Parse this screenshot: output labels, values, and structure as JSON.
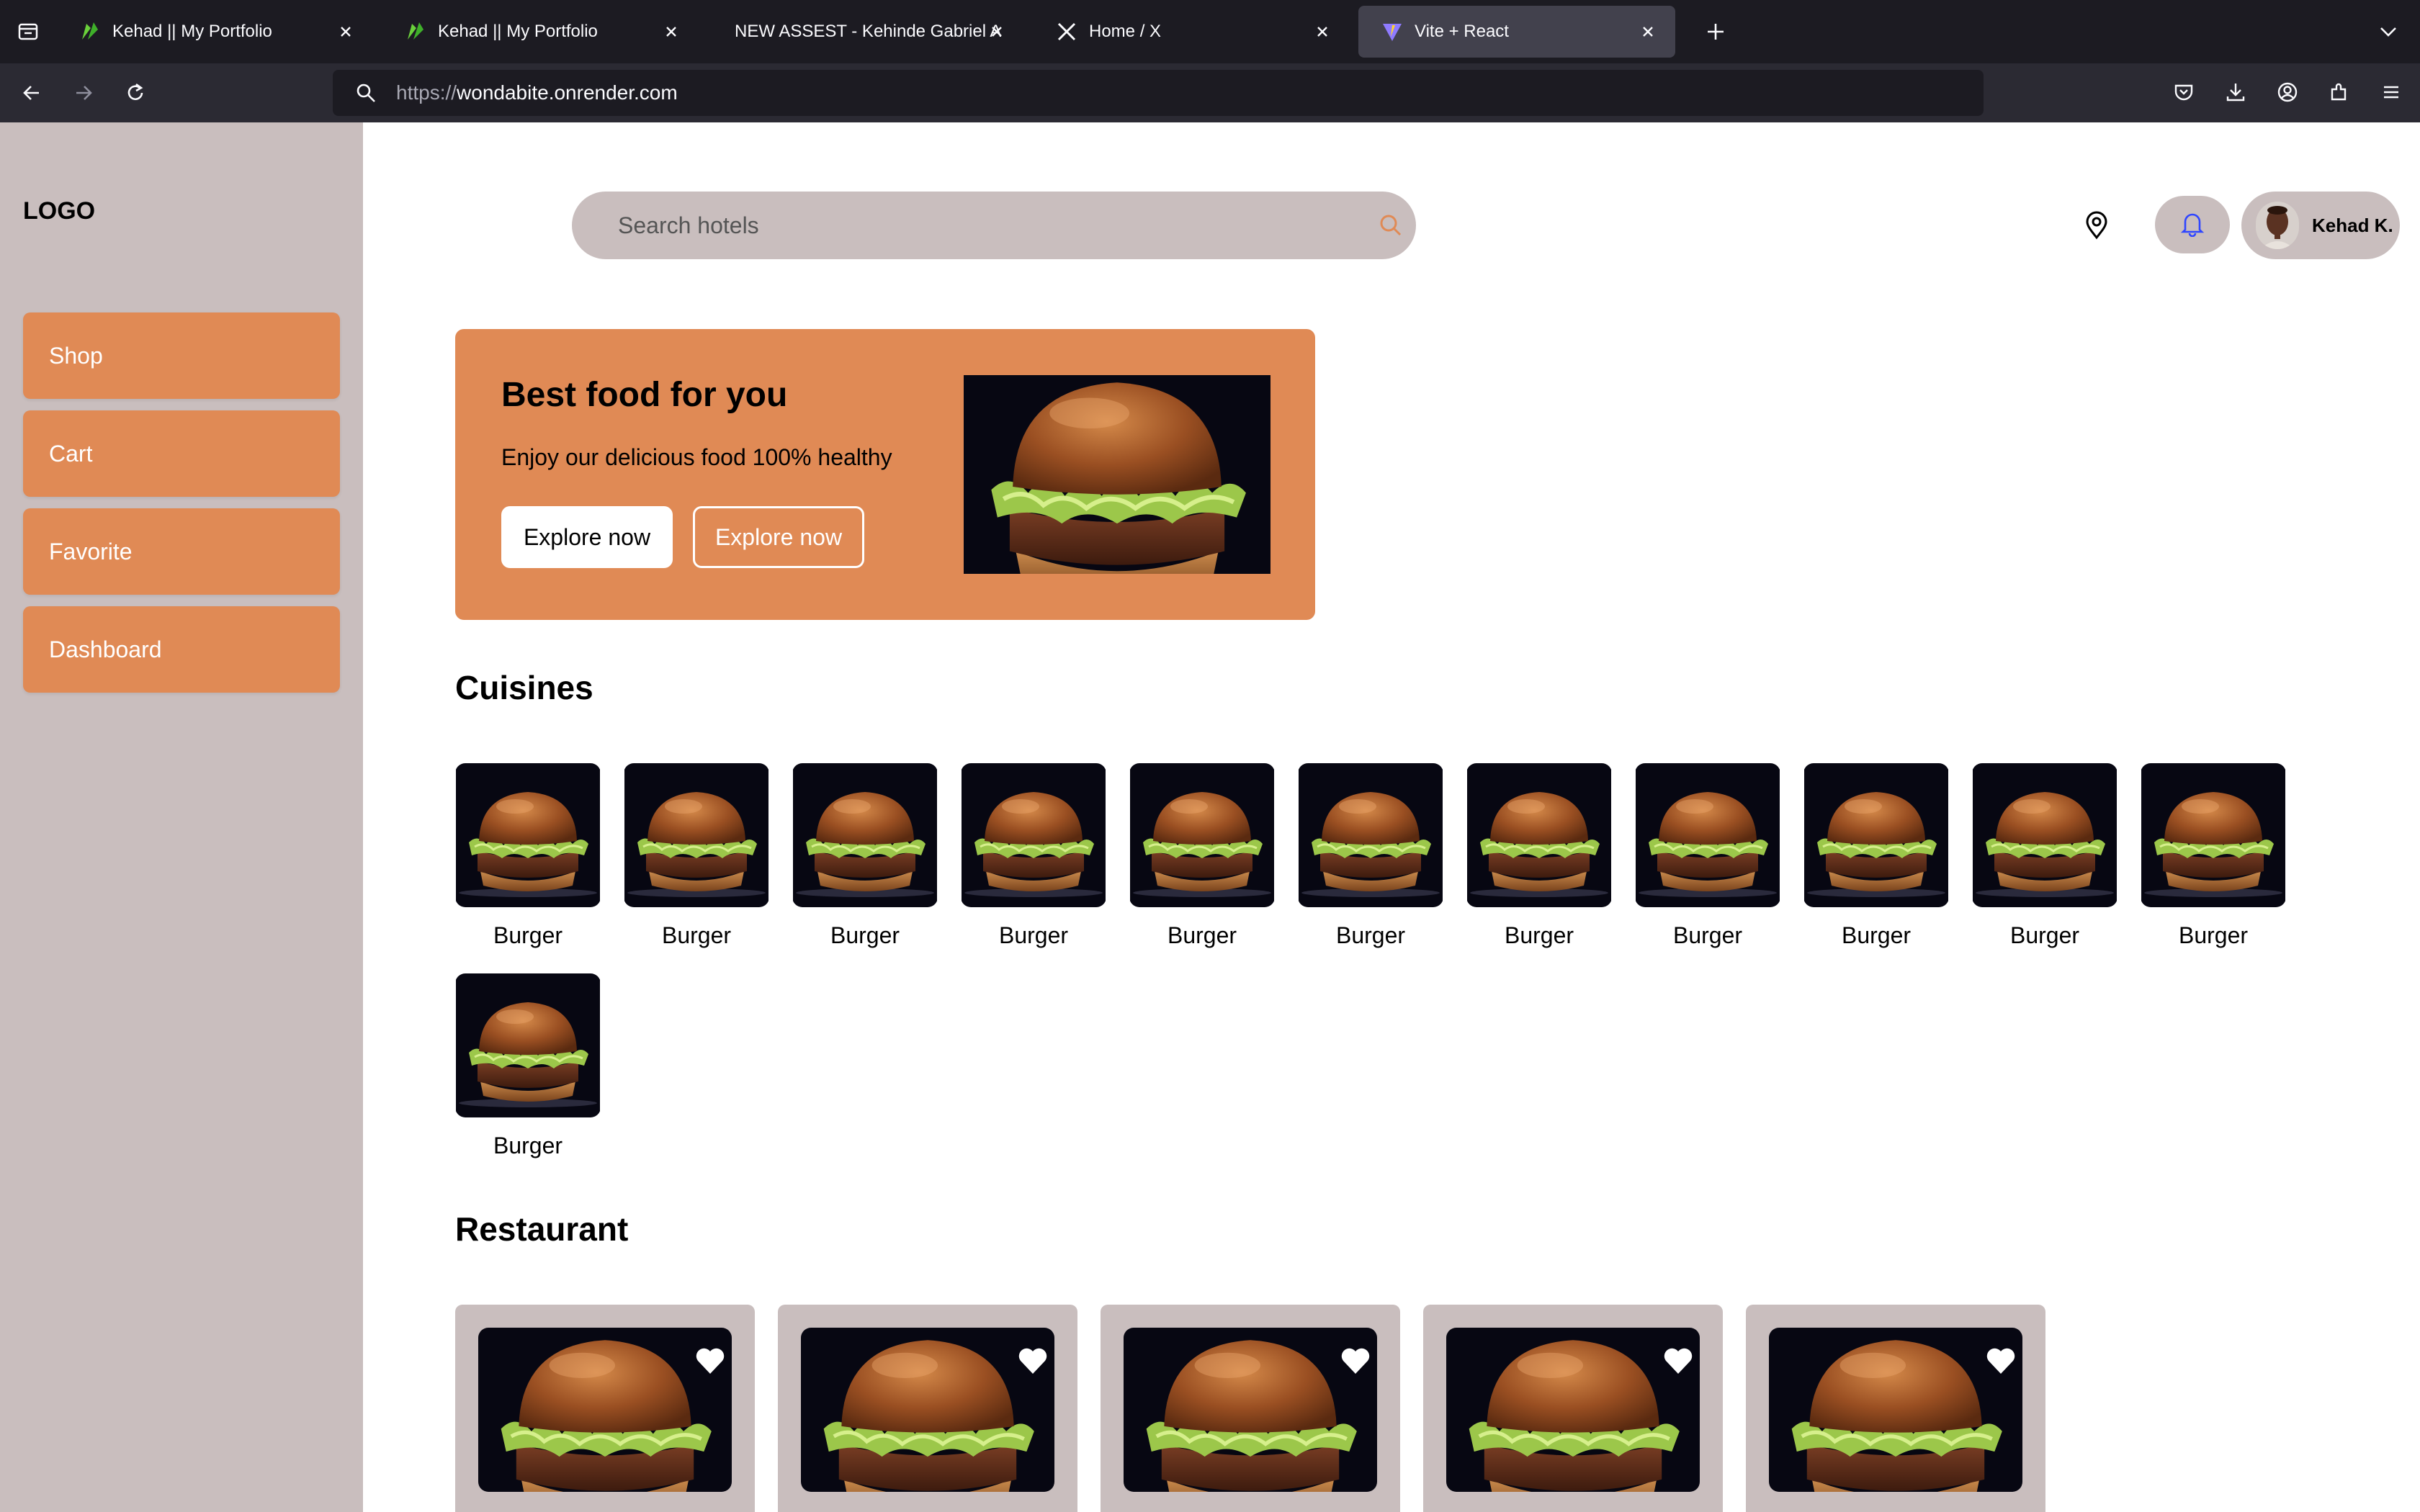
{
  "browser": {
    "tabs": [
      {
        "title": "Kehad || My Portfolio",
        "favicon": "green-leaf-icon",
        "active": false
      },
      {
        "title": "Kehad || My Portfolio",
        "favicon": "green-leaf-icon",
        "active": false
      },
      {
        "title": "NEW ASSEST - Kehinde Gabriel Adi",
        "favicon": "",
        "active": false
      },
      {
        "title": "Home / X",
        "favicon": "x-logo-icon",
        "active": false
      },
      {
        "title": "Vite + React",
        "favicon": "vite-logo-icon",
        "active": true
      }
    ],
    "url": {
      "scheme": "https://",
      "host": "wondabite.onrender.com"
    }
  },
  "sidebar": {
    "logo": "LOGO",
    "items": [
      {
        "label": "Shop"
      },
      {
        "label": "Cart"
      },
      {
        "label": "Favorite"
      },
      {
        "label": "Dashboard"
      }
    ]
  },
  "header": {
    "search_placeholder": "Search hotels",
    "user_name": "Kehad K."
  },
  "hero": {
    "title": "Best food for you",
    "subtitle": "Enjoy our delicious food 100% healthy",
    "primary_button": "Explore now",
    "secondary_button": "Explore now"
  },
  "cuisines": {
    "title": "Cuisines",
    "items": [
      "Burger",
      "Burger",
      "Burger",
      "Burger",
      "Burger",
      "Burger",
      "Burger",
      "Burger",
      "Burger",
      "Burger",
      "Burger",
      "Burger"
    ]
  },
  "restaurants": {
    "title": "Restaurant",
    "count": 5
  },
  "colors": {
    "accent": "#e08a55",
    "sidebar_bg": "#c9bebe",
    "chrome_dark": "#1c1b22"
  }
}
